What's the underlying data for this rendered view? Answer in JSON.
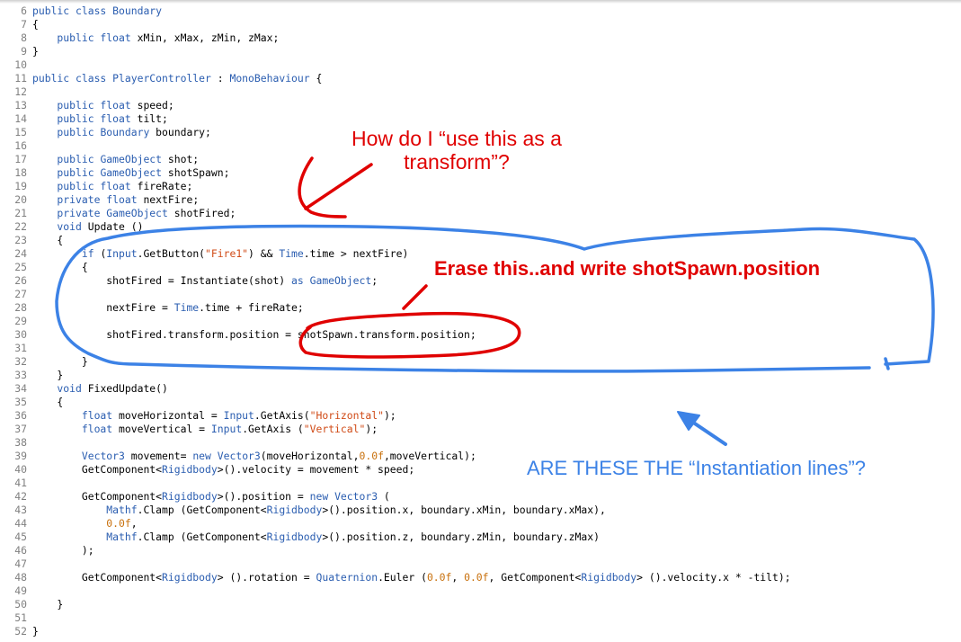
{
  "editor": {
    "lines": [
      {
        "num": "6",
        "tokens": [
          {
            "t": "public class ",
            "c": "kw"
          },
          {
            "t": "Boundary",
            "c": "type"
          }
        ]
      },
      {
        "num": "7",
        "tokens": [
          {
            "t": "{",
            "c": "plain"
          }
        ]
      },
      {
        "num": "8",
        "tokens": [
          {
            "t": "    public float ",
            "c": "kw"
          },
          {
            "t": "xMin, xMax, zMin, zMax;",
            "c": "plain"
          }
        ]
      },
      {
        "num": "9",
        "tokens": [
          {
            "t": "}",
            "c": "plain"
          }
        ]
      },
      {
        "num": "10",
        "tokens": []
      },
      {
        "num": "11",
        "tokens": [
          {
            "t": "public class ",
            "c": "kw"
          },
          {
            "t": "PlayerController",
            "c": "type"
          },
          {
            "t": " : ",
            "c": "plain"
          },
          {
            "t": "MonoBehaviour",
            "c": "type"
          },
          {
            "t": " {",
            "c": "plain"
          }
        ]
      },
      {
        "num": "12",
        "tokens": []
      },
      {
        "num": "13",
        "tokens": [
          {
            "t": "    public float ",
            "c": "kw"
          },
          {
            "t": "speed;",
            "c": "plain"
          }
        ]
      },
      {
        "num": "14",
        "tokens": [
          {
            "t": "    public float ",
            "c": "kw"
          },
          {
            "t": "tilt;",
            "c": "plain"
          }
        ]
      },
      {
        "num": "15",
        "tokens": [
          {
            "t": "    public ",
            "c": "kw"
          },
          {
            "t": "Boundary",
            "c": "type"
          },
          {
            "t": " boundary;",
            "c": "plain"
          }
        ]
      },
      {
        "num": "16",
        "tokens": []
      },
      {
        "num": "17",
        "tokens": [
          {
            "t": "    public ",
            "c": "kw"
          },
          {
            "t": "GameObject",
            "c": "type"
          },
          {
            "t": " shot;",
            "c": "plain"
          }
        ]
      },
      {
        "num": "18",
        "tokens": [
          {
            "t": "    public ",
            "c": "kw"
          },
          {
            "t": "GameObject",
            "c": "type"
          },
          {
            "t": " shotSpawn;",
            "c": "plain"
          }
        ]
      },
      {
        "num": "19",
        "tokens": [
          {
            "t": "    public float ",
            "c": "kw"
          },
          {
            "t": "fireRate;",
            "c": "plain"
          }
        ]
      },
      {
        "num": "20",
        "tokens": [
          {
            "t": "    private float ",
            "c": "kw"
          },
          {
            "t": "nextFire;",
            "c": "plain"
          }
        ]
      },
      {
        "num": "21",
        "tokens": [
          {
            "t": "    private ",
            "c": "kw"
          },
          {
            "t": "GameObject",
            "c": "type"
          },
          {
            "t": " shotFired;",
            "c": "plain"
          }
        ]
      },
      {
        "num": "22",
        "tokens": [
          {
            "t": "    void ",
            "c": "kw"
          },
          {
            "t": "Update ()",
            "c": "plain"
          }
        ]
      },
      {
        "num": "23",
        "tokens": [
          {
            "t": "    {",
            "c": "plain"
          }
        ]
      },
      {
        "num": "24",
        "tokens": [
          {
            "t": "        if ",
            "c": "kw"
          },
          {
            "t": "(",
            "c": "plain"
          },
          {
            "t": "Input",
            "c": "type"
          },
          {
            "t": ".GetButton(",
            "c": "plain"
          },
          {
            "t": "\"Fire1\"",
            "c": "str"
          },
          {
            "t": ") && ",
            "c": "plain"
          },
          {
            "t": "Time",
            "c": "type"
          },
          {
            "t": ".time > nextFire)",
            "c": "plain"
          }
        ]
      },
      {
        "num": "25",
        "tokens": [
          {
            "t": "        {",
            "c": "plain"
          }
        ]
      },
      {
        "num": "26",
        "tokens": [
          {
            "t": "            shotFired = Instantiate(shot) ",
            "c": "plain"
          },
          {
            "t": "as ",
            "c": "kw"
          },
          {
            "t": "GameObject",
            "c": "type"
          },
          {
            "t": ";",
            "c": "plain"
          }
        ]
      },
      {
        "num": "27",
        "tokens": []
      },
      {
        "num": "28",
        "tokens": [
          {
            "t": "            nextFire = ",
            "c": "plain"
          },
          {
            "t": "Time",
            "c": "type"
          },
          {
            "t": ".time + fireRate;",
            "c": "plain"
          }
        ]
      },
      {
        "num": "29",
        "tokens": []
      },
      {
        "num": "30",
        "tokens": [
          {
            "t": "            shotFired.transform.position = shotSpawn.transform.position;",
            "c": "plain"
          }
        ]
      },
      {
        "num": "31",
        "tokens": []
      },
      {
        "num": "32",
        "tokens": [
          {
            "t": "        }",
            "c": "plain"
          }
        ]
      },
      {
        "num": "33",
        "tokens": [
          {
            "t": "    }",
            "c": "plain"
          }
        ]
      },
      {
        "num": "34",
        "tokens": [
          {
            "t": "    void ",
            "c": "kw"
          },
          {
            "t": "FixedUpdate()",
            "c": "plain"
          }
        ]
      },
      {
        "num": "35",
        "tokens": [
          {
            "t": "    {",
            "c": "plain"
          }
        ]
      },
      {
        "num": "36",
        "tokens": [
          {
            "t": "        float ",
            "c": "kw"
          },
          {
            "t": "moveHorizontal = ",
            "c": "plain"
          },
          {
            "t": "Input",
            "c": "type"
          },
          {
            "t": ".GetAxis(",
            "c": "plain"
          },
          {
            "t": "\"Horizontal\"",
            "c": "str"
          },
          {
            "t": ");",
            "c": "plain"
          }
        ]
      },
      {
        "num": "37",
        "tokens": [
          {
            "t": "        float ",
            "c": "kw"
          },
          {
            "t": "moveVertical = ",
            "c": "plain"
          },
          {
            "t": "Input",
            "c": "type"
          },
          {
            "t": ".GetAxis (",
            "c": "plain"
          },
          {
            "t": "\"Vertical\"",
            "c": "str"
          },
          {
            "t": ");",
            "c": "plain"
          }
        ]
      },
      {
        "num": "38",
        "tokens": []
      },
      {
        "num": "39",
        "tokens": [
          {
            "t": "        ",
            "c": "plain"
          },
          {
            "t": "Vector3",
            "c": "type"
          },
          {
            "t": " movement= ",
            "c": "plain"
          },
          {
            "t": "new ",
            "c": "kw"
          },
          {
            "t": "Vector3",
            "c": "type"
          },
          {
            "t": "(moveHorizontal,",
            "c": "plain"
          },
          {
            "t": "0.0f",
            "c": "num"
          },
          {
            "t": ",moveVertical);",
            "c": "plain"
          }
        ]
      },
      {
        "num": "40",
        "tokens": [
          {
            "t": "        GetComponent<",
            "c": "plain"
          },
          {
            "t": "Rigidbody",
            "c": "type"
          },
          {
            "t": ">().velocity = movement * speed;",
            "c": "plain"
          }
        ]
      },
      {
        "num": "41",
        "tokens": []
      },
      {
        "num": "42",
        "tokens": [
          {
            "t": "        GetComponent<",
            "c": "plain"
          },
          {
            "t": "Rigidbody",
            "c": "type"
          },
          {
            "t": ">().position = ",
            "c": "plain"
          },
          {
            "t": "new ",
            "c": "kw"
          },
          {
            "t": "Vector3",
            "c": "type"
          },
          {
            "t": " (",
            "c": "plain"
          }
        ]
      },
      {
        "num": "43",
        "tokens": [
          {
            "t": "            ",
            "c": "plain"
          },
          {
            "t": "Mathf",
            "c": "type"
          },
          {
            "t": ".Clamp (GetComponent<",
            "c": "plain"
          },
          {
            "t": "Rigidbody",
            "c": "type"
          },
          {
            "t": ">().position.x, boundary.xMin, boundary.xMax),",
            "c": "plain"
          }
        ]
      },
      {
        "num": "44",
        "tokens": [
          {
            "t": "            ",
            "c": "plain"
          },
          {
            "t": "0.0f",
            "c": "num"
          },
          {
            "t": ",",
            "c": "plain"
          }
        ]
      },
      {
        "num": "45",
        "tokens": [
          {
            "t": "            ",
            "c": "plain"
          },
          {
            "t": "Mathf",
            "c": "type"
          },
          {
            "t": ".Clamp (GetComponent<",
            "c": "plain"
          },
          {
            "t": "Rigidbody",
            "c": "type"
          },
          {
            "t": ">().position.z, boundary.zMin, boundary.zMax)",
            "c": "plain"
          }
        ]
      },
      {
        "num": "46",
        "tokens": [
          {
            "t": "        );",
            "c": "plain"
          }
        ]
      },
      {
        "num": "47",
        "tokens": []
      },
      {
        "num": "48",
        "tokens": [
          {
            "t": "        GetComponent<",
            "c": "plain"
          },
          {
            "t": "Rigidbody",
            "c": "type"
          },
          {
            "t": "> ().rotation = ",
            "c": "plain"
          },
          {
            "t": "Quaternion",
            "c": "type"
          },
          {
            "t": ".Euler (",
            "c": "plain"
          },
          {
            "t": "0.0f",
            "c": "num"
          },
          {
            "t": ", ",
            "c": "plain"
          },
          {
            "t": "0.0f",
            "c": "num"
          },
          {
            "t": ", GetComponent<",
            "c": "plain"
          },
          {
            "t": "Rigidbody",
            "c": "type"
          },
          {
            "t": "> ().velocity.x * -tilt);",
            "c": "plain"
          }
        ]
      },
      {
        "num": "49",
        "tokens": []
      },
      {
        "num": "50",
        "tokens": [
          {
            "t": "    }",
            "c": "plain"
          }
        ]
      },
      {
        "num": "51",
        "tokens": []
      },
      {
        "num": "52",
        "tokens": [
          {
            "t": "}",
            "c": "plain"
          }
        ]
      }
    ]
  },
  "annotations": {
    "transform_question": {
      "line1": "How do I “use this as a",
      "line2": "transform”?"
    },
    "erase_note": "Erase this..and  write shotSpawn.position",
    "instantiation_question": "ARE THESE THE “Instantiation lines”?"
  },
  "colors": {
    "keyword": "#2a5db0",
    "type": "#2a5db0",
    "string": "#d04a16",
    "number": "#c8700c",
    "plain": "#000000",
    "line_number": "#808080",
    "annotation_red": "#e00000",
    "annotation_blue": "#3c82e6"
  }
}
